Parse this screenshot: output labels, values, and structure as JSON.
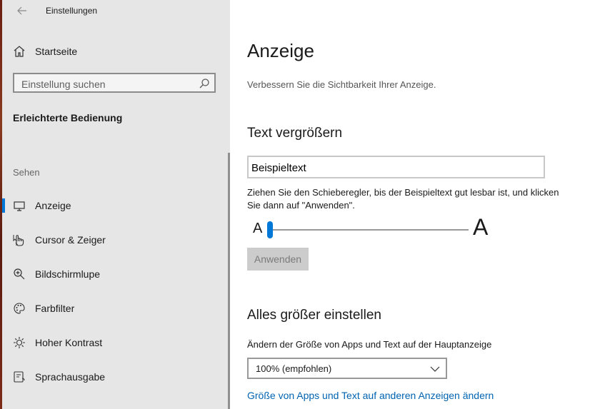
{
  "window": {
    "title": "Einstellungen"
  },
  "sidebar": {
    "home_label": "Startseite",
    "search_placeholder": "Einstellung suchen",
    "section_title": "Erleichterte Bedienung",
    "group_label": "Sehen",
    "items": [
      {
        "label": "Anzeige",
        "icon": "monitor-icon",
        "selected": true
      },
      {
        "label": "Cursor & Zeiger",
        "icon": "pointer-icon"
      },
      {
        "label": "Bildschirmlupe",
        "icon": "magnifier-icon"
      },
      {
        "label": "Farbfilter",
        "icon": "palette-icon"
      },
      {
        "label": "Hoher Kontrast",
        "icon": "sun-icon"
      },
      {
        "label": "Sprachausgabe",
        "icon": "narrator-icon"
      }
    ]
  },
  "main": {
    "title": "Anzeige",
    "subtitle": "Verbessern Sie die Sichtbarkeit Ihrer Anzeige.",
    "text_section": {
      "heading": "Text vergrößern",
      "sample_text": "Beispieltext",
      "description": "Ziehen Sie den Schieberegler, bis der Beispieltext gut lesbar ist, und klicken Sie dann auf \"Anwenden\".",
      "slider_small_label": "A",
      "slider_large_label": "A",
      "slider_value_fraction": 0.0,
      "apply_label": "Anwenden"
    },
    "scale_section": {
      "heading": "Alles größer einstellen",
      "label": "Ändern der Größe von Apps und Text auf der Hauptanzeige",
      "dropdown_value": "100% (empfohlen)",
      "link": "Größe von Apps und Text auf anderen Anzeigen ändern"
    }
  },
  "colors": {
    "accent": "#0078d7",
    "link": "#0063b1",
    "sidebar_bg": "#e6e6e6"
  }
}
